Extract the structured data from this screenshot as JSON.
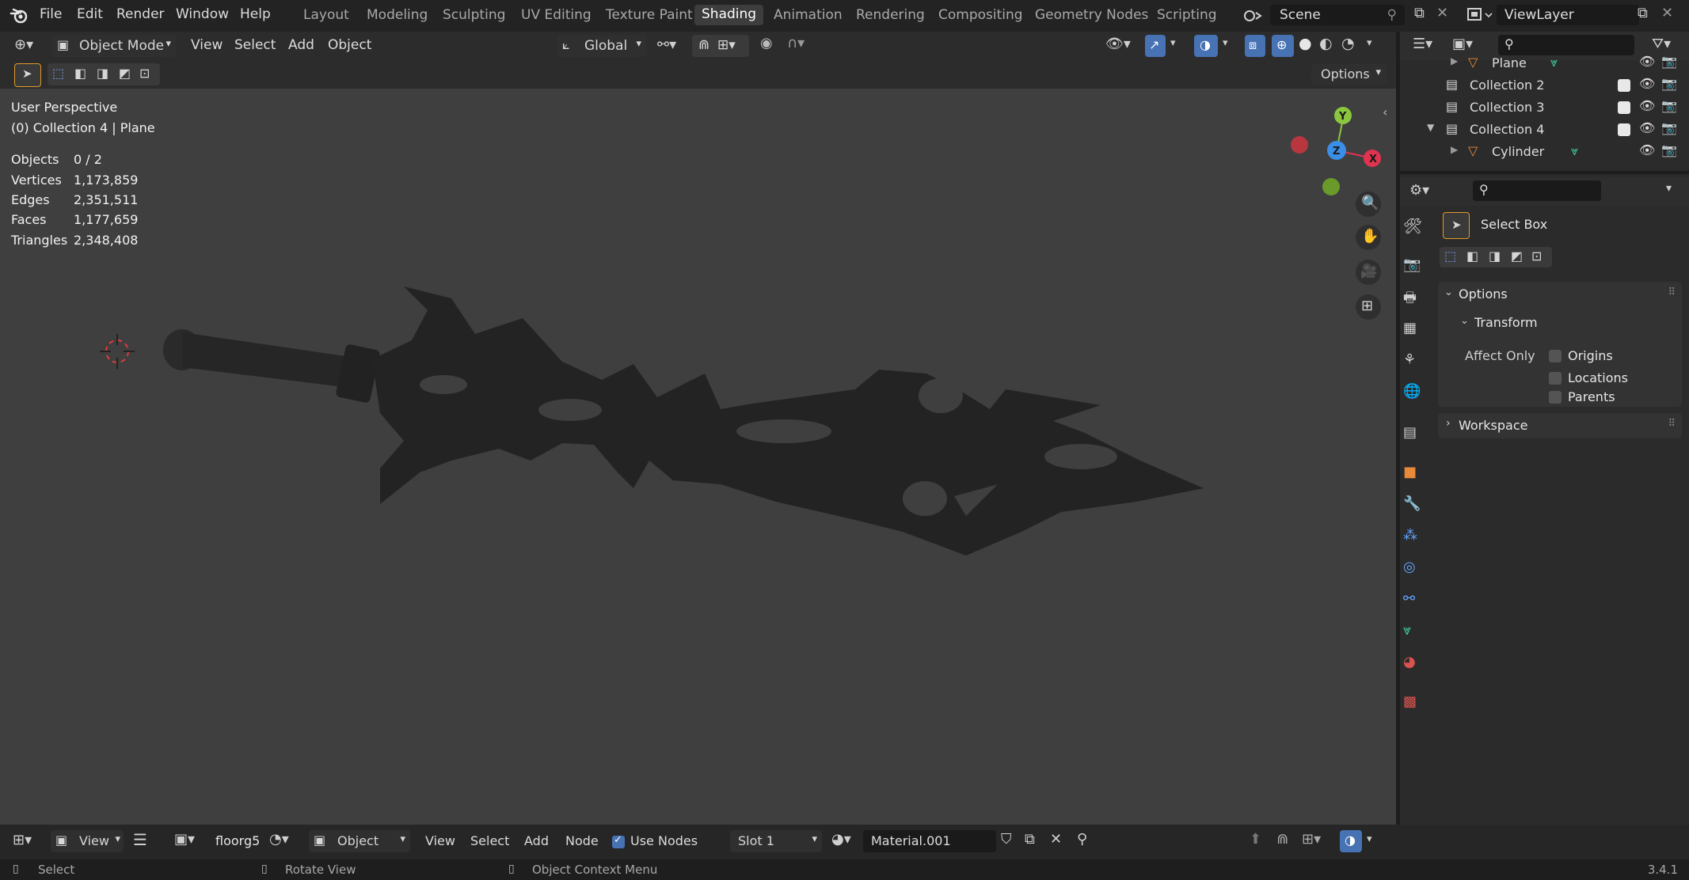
{
  "menu": {
    "file": "File",
    "edit": "Edit",
    "render": "Render",
    "window": "Window",
    "help": "Help"
  },
  "workspaces": [
    "Layout",
    "Modeling",
    "Sculpting",
    "UV Editing",
    "Texture Paint",
    "Shading",
    "Animation",
    "Rendering",
    "Compositing",
    "Geometry Nodes",
    "Scripting"
  ],
  "active_workspace": "Shading",
  "scene": {
    "name": "Scene",
    "view_layer": "ViewLayer"
  },
  "viewport_header": {
    "mode": "Object Mode",
    "view": "View",
    "select": "Select",
    "add": "Add",
    "object": "Object",
    "orientation": "Global",
    "options": "Options"
  },
  "viewport": {
    "perspective": "User Perspective",
    "collection": "(0) Collection 4 | Plane",
    "stats": [
      {
        "label": "Objects",
        "value": "0 / 2"
      },
      {
        "label": "Vertices",
        "value": "1,173,859"
      },
      {
        "label": "Edges",
        "value": "2,351,511"
      },
      {
        "label": "Faces",
        "value": "1,177,659"
      },
      {
        "label": "Triangles",
        "value": "2,348,408"
      }
    ],
    "gizmo": {
      "y": "Y",
      "z": "Z",
      "x": "X"
    }
  },
  "outliner": {
    "rows": [
      {
        "label": "Plane",
        "type": "object"
      },
      {
        "label": "Collection 2",
        "type": "collection"
      },
      {
        "label": "Collection 3",
        "type": "collection"
      },
      {
        "label": "Collection 4",
        "type": "collection"
      },
      {
        "label": "Cylinder",
        "type": "object"
      }
    ]
  },
  "properties": {
    "tool_name": "Select Box",
    "options_title": "Options",
    "transform_title": "Transform",
    "affect_only": "Affect Only",
    "origins": "Origins",
    "locations": "Locations",
    "parents": "Parents",
    "workspace_title": "Workspace"
  },
  "node_header": {
    "view": "View",
    "slot_name": "floorg5",
    "object": "Object",
    "view2": "View",
    "select": "Select",
    "add": "Add",
    "node": "Node",
    "use_nodes": "Use Nodes",
    "slot": "Slot 1",
    "material": "Material.001"
  },
  "statusbar": {
    "select": "Select",
    "rotate": "Rotate View",
    "context": "Object Context Menu",
    "version": "3.4.1"
  },
  "colors": {
    "accent": "#4772b3",
    "active_tab": "#3d3d3d",
    "viewport_bg": "#3f3f3f",
    "axis_x": "#e0334f",
    "axis_y": "#8bc63f",
    "axis_z": "#3a8ee6",
    "object_orange": "#e88a3a"
  }
}
